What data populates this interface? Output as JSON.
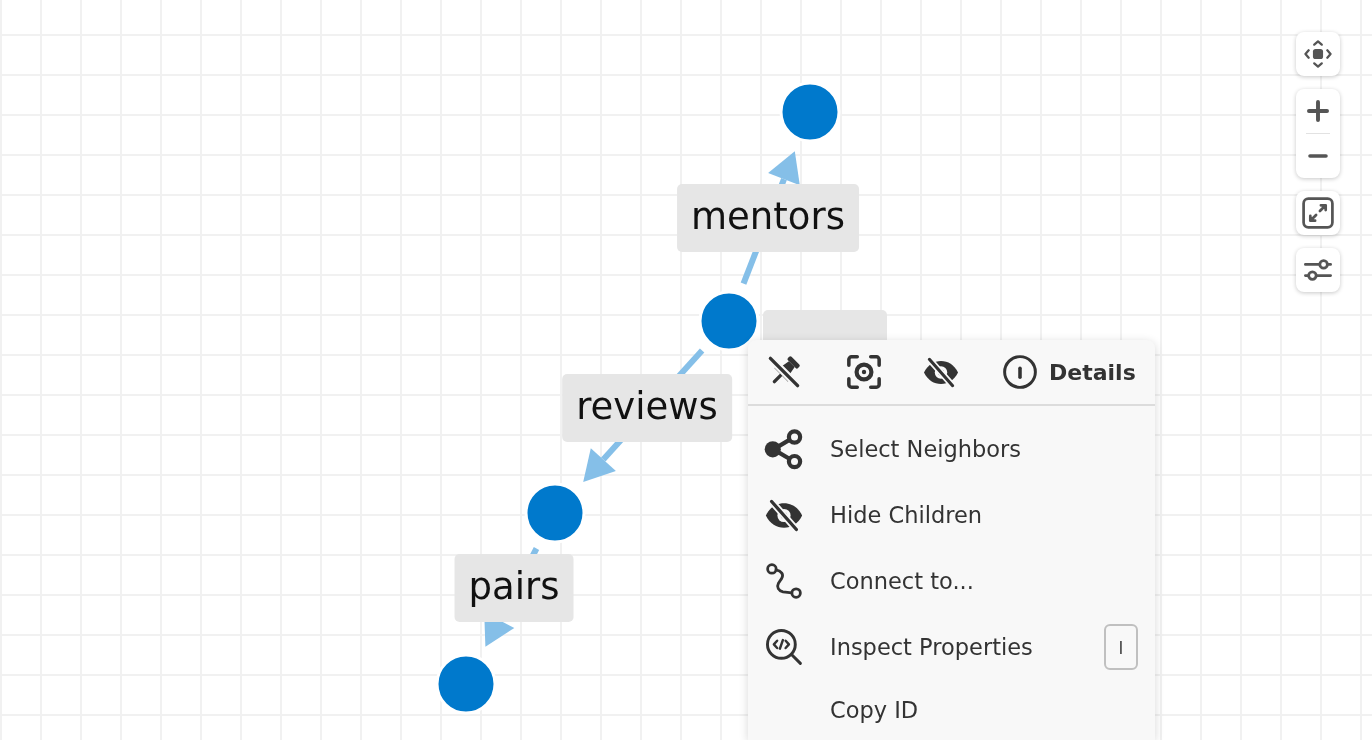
{
  "graph": {
    "edges": [
      {
        "kind": "labeled",
        "label": "mentors"
      },
      {
        "kind": "labeled",
        "label": "reviews"
      },
      {
        "kind": "labeled",
        "label": "pairs"
      },
      {
        "kind": "covered"
      }
    ]
  },
  "node_menu": {
    "details_button": "Details",
    "items": [
      {
        "label": "Select Neighbors"
      },
      {
        "label": "Hide Children"
      },
      {
        "label": "Connect to..."
      },
      {
        "label": "Inspect Properties",
        "shortcut": "I"
      },
      {
        "label": "Copy ID"
      }
    ]
  }
}
